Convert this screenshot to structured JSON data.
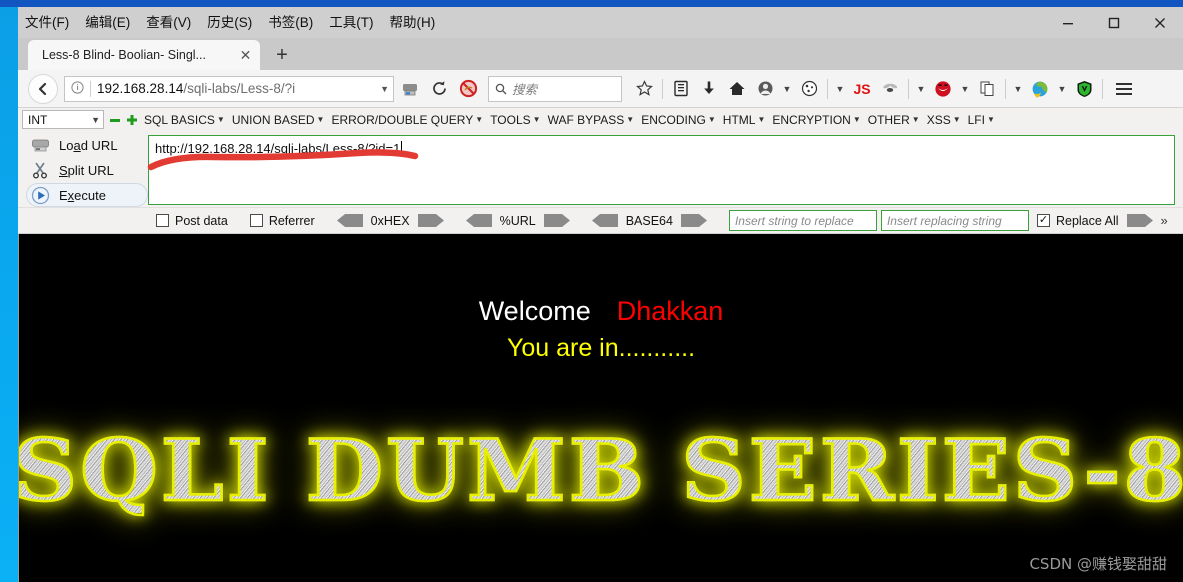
{
  "window": {
    "controls": {
      "minimize": "—",
      "maximize": "□",
      "close": "✕"
    }
  },
  "menubar": {
    "items": [
      {
        "label": "文件(F)",
        "accel": "F"
      },
      {
        "label": "编辑(E)",
        "accel": "E"
      },
      {
        "label": "查看(V)",
        "accel": "V"
      },
      {
        "label": "历史(S)",
        "accel": "S"
      },
      {
        "label": "书签(B)",
        "accel": "B"
      },
      {
        "label": "工具(T)",
        "accel": "T"
      },
      {
        "label": "帮助(H)",
        "accel": "H"
      }
    ]
  },
  "tabs": {
    "active": {
      "title": "Less-8 Blind- Boolian- Singl...",
      "close": "✕"
    },
    "new_tab": "+"
  },
  "navbar": {
    "back": "←",
    "identity_icon": "info-icon",
    "url_host": "192.168.28.14",
    "url_path": "/sqli-labs/Less-8/?i",
    "reload": "⟳",
    "search_placeholder": "搜索",
    "icons": [
      "shield-blocked-icon",
      "bookmark-star-icon",
      "library-icon",
      "downloads-icon",
      "home-icon",
      "account-icon",
      "cookie-icon",
      "js-icon",
      "fly-icon",
      "red-face-icon",
      "copy-icon",
      "colorful-icon",
      "green-shield-icon",
      "hamburger-menu-icon"
    ]
  },
  "hackbar": {
    "type_select": {
      "value": "INT"
    },
    "menus": [
      "SQL BASICS",
      "UNION BASED",
      "ERROR/DOUBLE QUERY",
      "TOOLS",
      "WAF BYPASS",
      "ENCODING",
      "HTML",
      "ENCRYPTION",
      "OTHER",
      "XSS",
      "LFI"
    ],
    "buttons": [
      {
        "label": "Load URL",
        "accel_index": 3,
        "icon": "load-url-icon"
      },
      {
        "label": "Split URL",
        "accel_index": 0,
        "icon": "split-url-icon"
      },
      {
        "label": "Execute",
        "accel_index": 1,
        "icon": "execute-icon"
      }
    ],
    "url_textarea": "http://192.168.28.14/sqli-labs/Less-8/?id=1",
    "options": {
      "post_data": {
        "label": "Post data",
        "checked": false
      },
      "referrer": {
        "label": "Referrer",
        "checked": false
      },
      "hex": "0xHEX",
      "url_encode": "%URL",
      "base64": "BASE64",
      "replace_from_placeholder": "Insert string to replace",
      "replace_to_placeholder": "Insert replacing string",
      "replace_all": {
        "label": "Replace All",
        "checked": true
      }
    }
  },
  "page": {
    "welcome": "Welcome",
    "username": "Dhakkan",
    "status": "You are in...........",
    "logo": "SQLI DUMB SERIES-8",
    "watermark": "CSDN @赚钱娶甜甜"
  },
  "colors": {
    "welcome": "#ffffff",
    "username": "#ff0000",
    "status": "#ffff00",
    "logo_glow": "#e8f000",
    "page_bg": "#000000",
    "annotation": "#e03030",
    "input_border": "#3aa03a"
  }
}
